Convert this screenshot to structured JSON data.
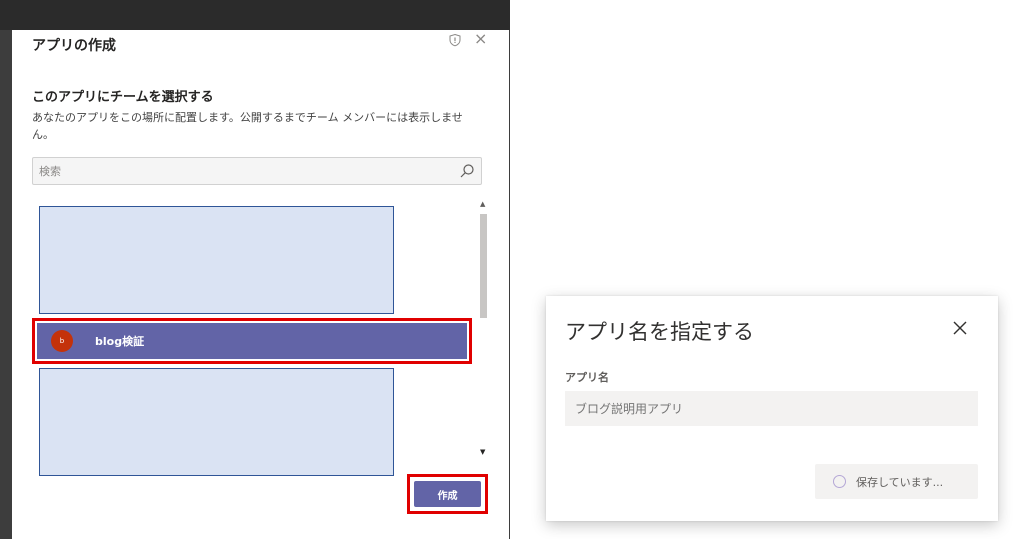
{
  "left_dialog": {
    "title": "アプリの作成",
    "section_title": "このアプリにチームを選択する",
    "section_desc": "あなたのアプリをこの場所に配置します。公開するまでチーム メンバーには表示しません。",
    "search": {
      "placeholder": "検索"
    },
    "teams": [
      {
        "avatar": "b",
        "name": "blog検証"
      }
    ],
    "create_label": "作成",
    "close_glyph": "×"
  },
  "right_dialog": {
    "title": "アプリ名を指定する",
    "field_label": "アプリ名",
    "field_placeholder": "ブログ説明用アプリ",
    "save_label": "保存しています..."
  },
  "colors": {
    "accent": "#6264a7",
    "highlight_border": "#e00000",
    "avatar": "#c4320a",
    "placeholder_fill": "#dae3f3",
    "placeholder_border": "#2f5597"
  },
  "icons": [
    "shield-icon",
    "close-icon",
    "search-icon",
    "spinner-icon",
    "scroll-up-icon",
    "scroll-down-icon"
  ]
}
